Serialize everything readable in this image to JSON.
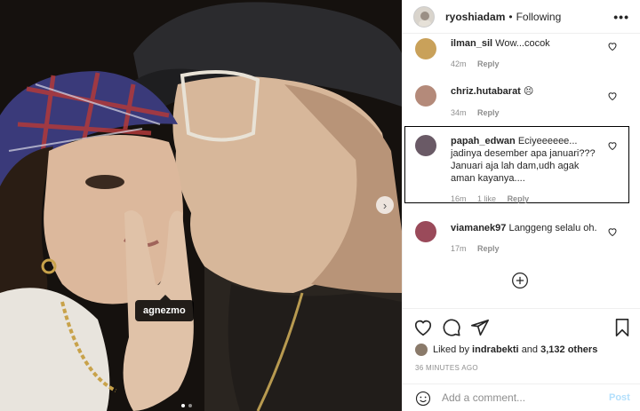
{
  "photo": {
    "tag_label": "agnezmo",
    "next_arrow": "chevron-right-icon",
    "carousel_pages": 2,
    "carousel_active": 1
  },
  "header": {
    "username": "ryoshiadam",
    "separator": "•",
    "follow_status": "Following",
    "more_icon": "more-horizontal-icon"
  },
  "comments": [
    {
      "user": "ilman_sil",
      "text": "Wow...cocok",
      "age": "42m",
      "likes": "",
      "reply": "Reply",
      "avatar_color": "#c9a15a"
    },
    {
      "user": "chriz.hutabarat",
      "text": "😣",
      "age": "34m",
      "likes": "",
      "reply": "Reply",
      "avatar_color": "#b48a7a"
    },
    {
      "user": "papah_edwan",
      "text": "Eciyeeeeee... jadinya desember apa januari??? Januari aja lah dam,udh agak aman kayanya....",
      "age": "16m",
      "likes": "1 like",
      "reply": "Reply",
      "avatar_color": "#6a5a66"
    },
    {
      "user": "viamanek97",
      "text": "Langgeng selalu oh.",
      "age": "17m",
      "likes": "",
      "reply": "Reply",
      "avatar_color": "#9a4a5a"
    }
  ],
  "load_more_icon": "plus-circle-icon",
  "actions": {
    "like_icon": "heart-icon",
    "comment_icon": "comment-icon",
    "share_icon": "send-icon",
    "save_icon": "bookmark-icon"
  },
  "likes": {
    "prefix": "Liked by",
    "user": "indrabekti",
    "joiner": "and",
    "others": "3,132 others"
  },
  "timestamp": "36 MINUTES AGO",
  "add_comment": {
    "placeholder": "Add a comment...",
    "post_label": "Post",
    "post_color": "#b2dffc"
  }
}
